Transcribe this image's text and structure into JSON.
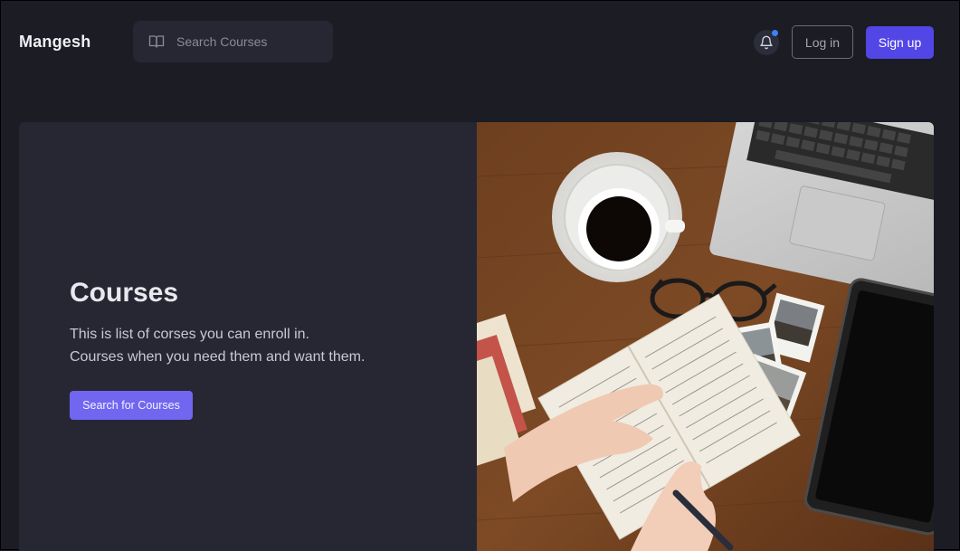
{
  "navbar": {
    "brand": "Mangesh",
    "search": {
      "placeholder": "Search Courses",
      "icon": "book-open-icon"
    },
    "notification_icon": "bell-icon",
    "login_label": "Log in",
    "signup_label": "Sign up"
  },
  "hero": {
    "title": "Courses",
    "description_line1": "This is list of corses you can enroll in.",
    "description_line2": "Courses when you need them and want them.",
    "cta_label": "Search for Courses",
    "image_subject": "desk-with-coffee-laptop-notebook"
  },
  "colors": {
    "background": "#1b1c24",
    "card": "#262733",
    "primary": "#5346e6",
    "cta": "#7166f0",
    "notification_dot": "#3b82f6"
  }
}
